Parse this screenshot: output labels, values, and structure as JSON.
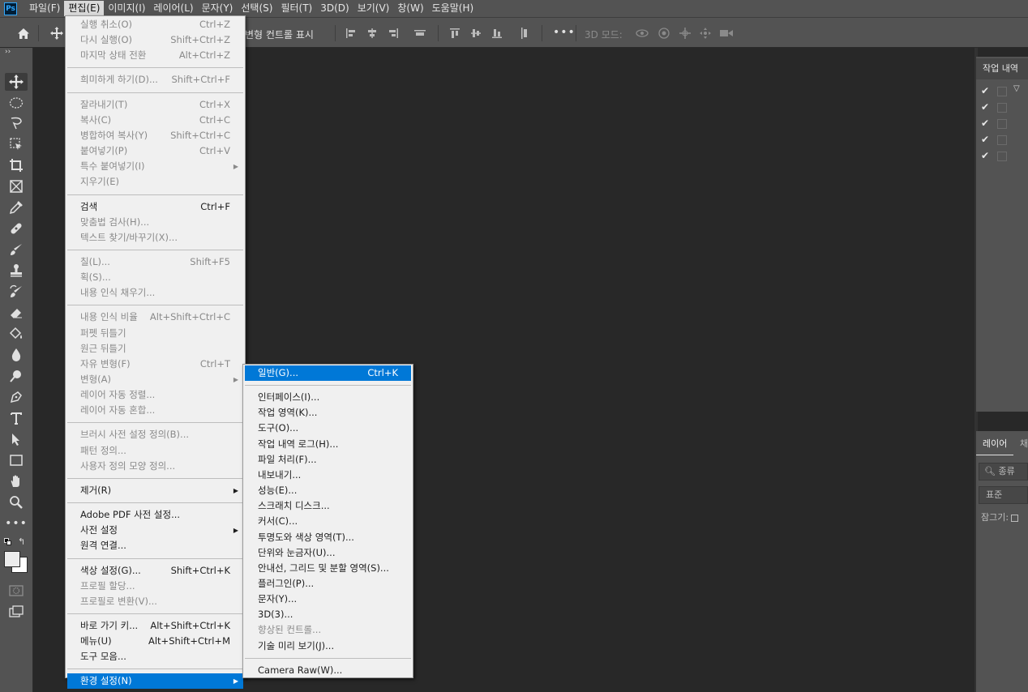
{
  "app": {
    "logo": "Ps"
  },
  "menubar": [
    {
      "label": "파일(F)"
    },
    {
      "label": "편집(E)",
      "active": true
    },
    {
      "label": "이미지(I)"
    },
    {
      "label": "레이어(L)"
    },
    {
      "label": "문자(Y)"
    },
    {
      "label": "선택(S)"
    },
    {
      "label": "필터(T)"
    },
    {
      "label": "3D(D)"
    },
    {
      "label": "보기(V)"
    },
    {
      "label": "창(W)"
    },
    {
      "label": "도움말(H)"
    }
  ],
  "optionsbar": {
    "transform_controls": "변형 컨트롤 표시",
    "mode_3d": "3D 모드:",
    "more": "•••"
  },
  "edit_menu": [
    {
      "label": "실행 취소(O)",
      "shortcut": "Ctrl+Z",
      "disabled": true
    },
    {
      "label": "다시 실행(O)",
      "shortcut": "Shift+Ctrl+Z",
      "disabled": true
    },
    {
      "label": "마지막 상태 전환",
      "shortcut": "Alt+Ctrl+Z",
      "disabled": true
    },
    {
      "sep": true
    },
    {
      "label": "희미하게 하기(D)...",
      "shortcut": "Shift+Ctrl+F",
      "disabled": true
    },
    {
      "sep": true
    },
    {
      "label": "잘라내기(T)",
      "shortcut": "Ctrl+X",
      "disabled": true
    },
    {
      "label": "복사(C)",
      "shortcut": "Ctrl+C",
      "disabled": true
    },
    {
      "label": "병합하여 복사(Y)",
      "shortcut": "Shift+Ctrl+C",
      "disabled": true
    },
    {
      "label": "붙여넣기(P)",
      "shortcut": "Ctrl+V",
      "disabled": true
    },
    {
      "label": "특수 붙여넣기(I)",
      "submenu": true,
      "disabled": true
    },
    {
      "label": "지우기(E)",
      "disabled": true
    },
    {
      "sep": true
    },
    {
      "label": "검색",
      "shortcut": "Ctrl+F"
    },
    {
      "label": "맞춤법 검사(H)...",
      "disabled": true
    },
    {
      "label": "텍스트 찾기/바꾸기(X)...",
      "disabled": true
    },
    {
      "sep": true
    },
    {
      "label": "칠(L)...",
      "shortcut": "Shift+F5",
      "disabled": true
    },
    {
      "label": "획(S)...",
      "disabled": true
    },
    {
      "label": "내용 인식 채우기...",
      "disabled": true
    },
    {
      "sep": true
    },
    {
      "label": "내용 인식 비율",
      "shortcut": "Alt+Shift+Ctrl+C",
      "disabled": true
    },
    {
      "label": "퍼펫 뒤틀기",
      "disabled": true
    },
    {
      "label": "원근 뒤틀기",
      "disabled": true
    },
    {
      "label": "자유 변형(F)",
      "shortcut": "Ctrl+T",
      "disabled": true
    },
    {
      "label": "변형(A)",
      "submenu": true,
      "disabled": true
    },
    {
      "label": "레이어 자동 정렬...",
      "disabled": true
    },
    {
      "label": "레이어 자동 혼합...",
      "disabled": true
    },
    {
      "sep": true
    },
    {
      "label": "브러시 사전 설정 정의(B)...",
      "disabled": true
    },
    {
      "label": "패턴 정의...",
      "disabled": true
    },
    {
      "label": "사용자 정의 모양 정의...",
      "disabled": true
    },
    {
      "sep": true
    },
    {
      "label": "제거(R)",
      "submenu": true
    },
    {
      "sep": true
    },
    {
      "label": "Adobe PDF 사전 설정..."
    },
    {
      "label": "사전 설정",
      "submenu": true
    },
    {
      "label": "원격 연결..."
    },
    {
      "sep": true
    },
    {
      "label": "색상 설정(G)...",
      "shortcut": "Shift+Ctrl+K"
    },
    {
      "label": "프로필 할당...",
      "disabled": true
    },
    {
      "label": "프로필로 변환(V)...",
      "disabled": true
    },
    {
      "sep": true
    },
    {
      "label": "바로 가기 키...",
      "shortcut": "Alt+Shift+Ctrl+K"
    },
    {
      "label": "메뉴(U)",
      "shortcut": "Alt+Shift+Ctrl+M"
    },
    {
      "label": "도구 모음..."
    },
    {
      "sep": true
    },
    {
      "label": "환경 설정(N)",
      "submenu": true,
      "highlighted": true
    }
  ],
  "prefs_menu": [
    {
      "label": "일반(G)...",
      "shortcut": "Ctrl+K",
      "highlighted": true
    },
    {
      "sep": true
    },
    {
      "label": "인터페이스(I)..."
    },
    {
      "label": "작업 영역(K)..."
    },
    {
      "label": "도구(O)..."
    },
    {
      "label": "작업 내역 로그(H)..."
    },
    {
      "label": "파일 처리(F)..."
    },
    {
      "label": "내보내기..."
    },
    {
      "label": "성능(E)..."
    },
    {
      "label": "스크래치 디스크..."
    },
    {
      "label": "커서(C)..."
    },
    {
      "label": "투명도와 색상 영역(T)..."
    },
    {
      "label": "단위와 눈금자(U)..."
    },
    {
      "label": "안내선, 그리드 및 분할 영역(S)..."
    },
    {
      "label": "플러그인(P)..."
    },
    {
      "label": "문자(Y)..."
    },
    {
      "label": "3D(3)..."
    },
    {
      "label": "향상된 컨트롤...",
      "disabled": true
    },
    {
      "label": "기술 미리 보기(J)..."
    },
    {
      "sep": true
    },
    {
      "label": "Camera Raw(W)..."
    }
  ],
  "panels": {
    "history_tab": "작업 내역",
    "layers_tab": "레이어",
    "layers_tab2": "채",
    "layers_filter": "종류",
    "blend_mode": "표준",
    "lock_label": "잠그기:"
  }
}
